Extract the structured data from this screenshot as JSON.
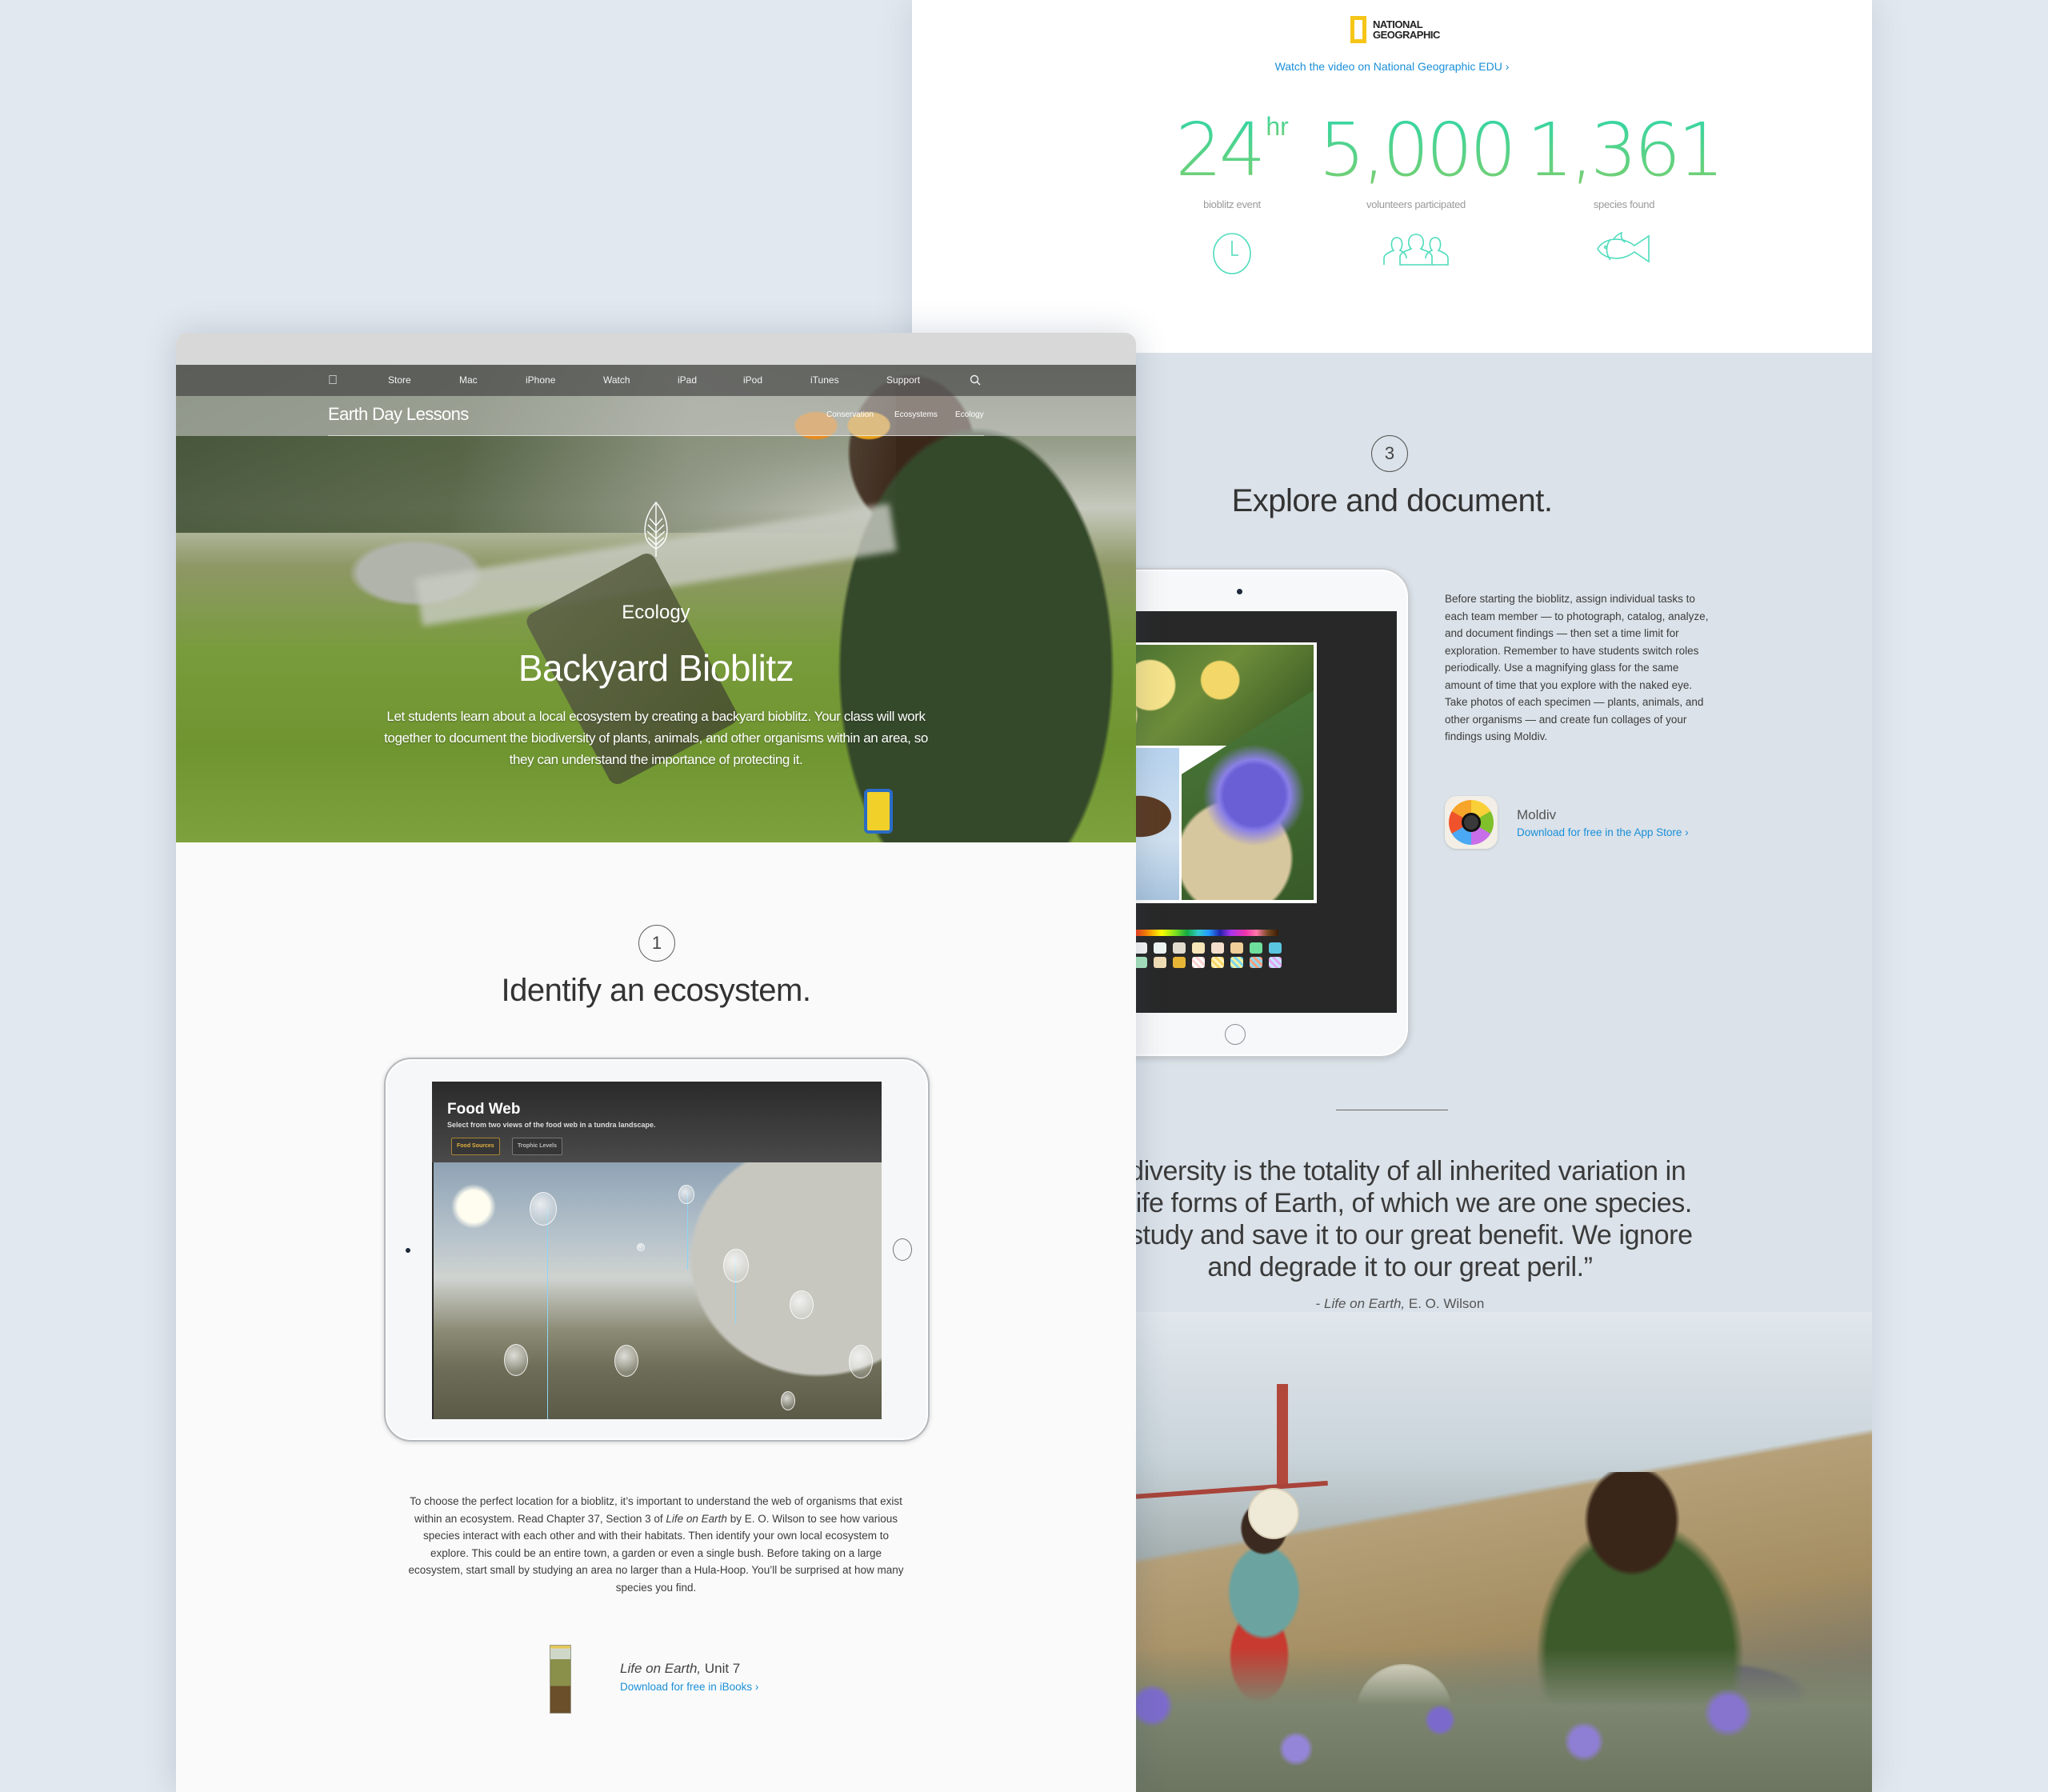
{
  "right_panel": {
    "partner": {
      "logo_line1": "NATIONAL",
      "logo_line2": "GEOGRAPHIC",
      "link": "Watch the video on National Geographic EDU ›"
    },
    "stats": [
      {
        "value": "24",
        "unit": "hr",
        "label": "bioblitz event",
        "icon": "clock-icon"
      },
      {
        "value": "5,000",
        "unit": "",
        "label": "volunteers participated",
        "icon": "people-icon"
      },
      {
        "value": "1,361",
        "unit": "",
        "label": "species found",
        "icon": "fish-icon"
      }
    ],
    "step": {
      "number": "3",
      "title": "Explore and document.",
      "body": "Before starting the bioblitz, assign individual tasks to each team member — to photograph, catalog, analyze, and document findings — then set a time limit for exploration. Remember to have students switch roles periodically. Use a magnifying glass for the same amount of time that you explore with the naked eye. Take photos of each specimen — plants, animals, and other organisms — and create fun collages of your findings using Moldiv."
    },
    "app": {
      "name": "Moldiv",
      "link": "Download for free in the App Store ›"
    },
    "quote": {
      "text": "odiversity is the totality of all inherited variation in e life forms of Earth, of which we are one species. e study and save it to our great benefit. We ignore and degrade it to our great peril.”",
      "lines": [
        "odiversity is the totality of all inherited variation in",
        "e life forms of Earth, of which we are one species.",
        "e study and save it to our great benefit. We ignore",
        "and degrade it to our great peril.”"
      ],
      "attribution_prefix": "- ",
      "attribution_source": "Life on Earth,",
      "attribution_author": " E. O. Wilson"
    }
  },
  "left_panel": {
    "global_nav": {
      "apple": "",
      "items": [
        "Store",
        "Mac",
        "iPhone",
        "Watch",
        "iPad",
        "iPod",
        "iTunes",
        "Support"
      ]
    },
    "subnav": {
      "title": "Earth Day Lessons",
      "links": [
        "Conservation",
        "Ecosystems",
        "Ecology"
      ]
    },
    "hero": {
      "category": "Ecology",
      "title": "Backyard Bioblitz",
      "description": "Let students learn about a local ecosystem by creating a backyard bioblitz. Your class will work together to document the biodiversity of plants, animals, and other organisms within an area, so they can understand the importance of protecting it."
    },
    "step": {
      "number": "1",
      "title": "Identify an ecosystem.",
      "body_part1": "To choose the perfect location for a bioblitz, it’s important to understand the web of organisms that exist within an ecosystem. Read Chapter 37, Section 3 of ",
      "body_italic": "Life on Earth",
      "body_part2": " by E. O. Wilson to see how various species interact with each other and with their habitats. Then identify your own local ecosystem to explore. This could be an entire town, a garden or even a single bush. Before taking on a large ecosystem, start small by studying an area no larger than a Hula-Hoop. You’ll be surprised at how many species you find."
    },
    "ipad_app": {
      "title": "Food Web",
      "subtitle": "Select from two views of the food web in a tundra landscape.",
      "tabs": [
        {
          "label": "Food Sources",
          "active": true
        },
        {
          "label": "Trophic Levels",
          "active": false
        }
      ]
    },
    "book": {
      "title_italic": "Life on Earth,",
      "title_rest": " Unit 7",
      "link": "Download for free in iBooks ›"
    }
  },
  "colors": {
    "page_bg": "#e2e8ef",
    "link_blue": "#1a8fd8",
    "stat_gradient_top": "#2fd6a8",
    "stat_gradient_bottom": "#7ccf6d",
    "natgeo_yellow": "#f5c518"
  }
}
